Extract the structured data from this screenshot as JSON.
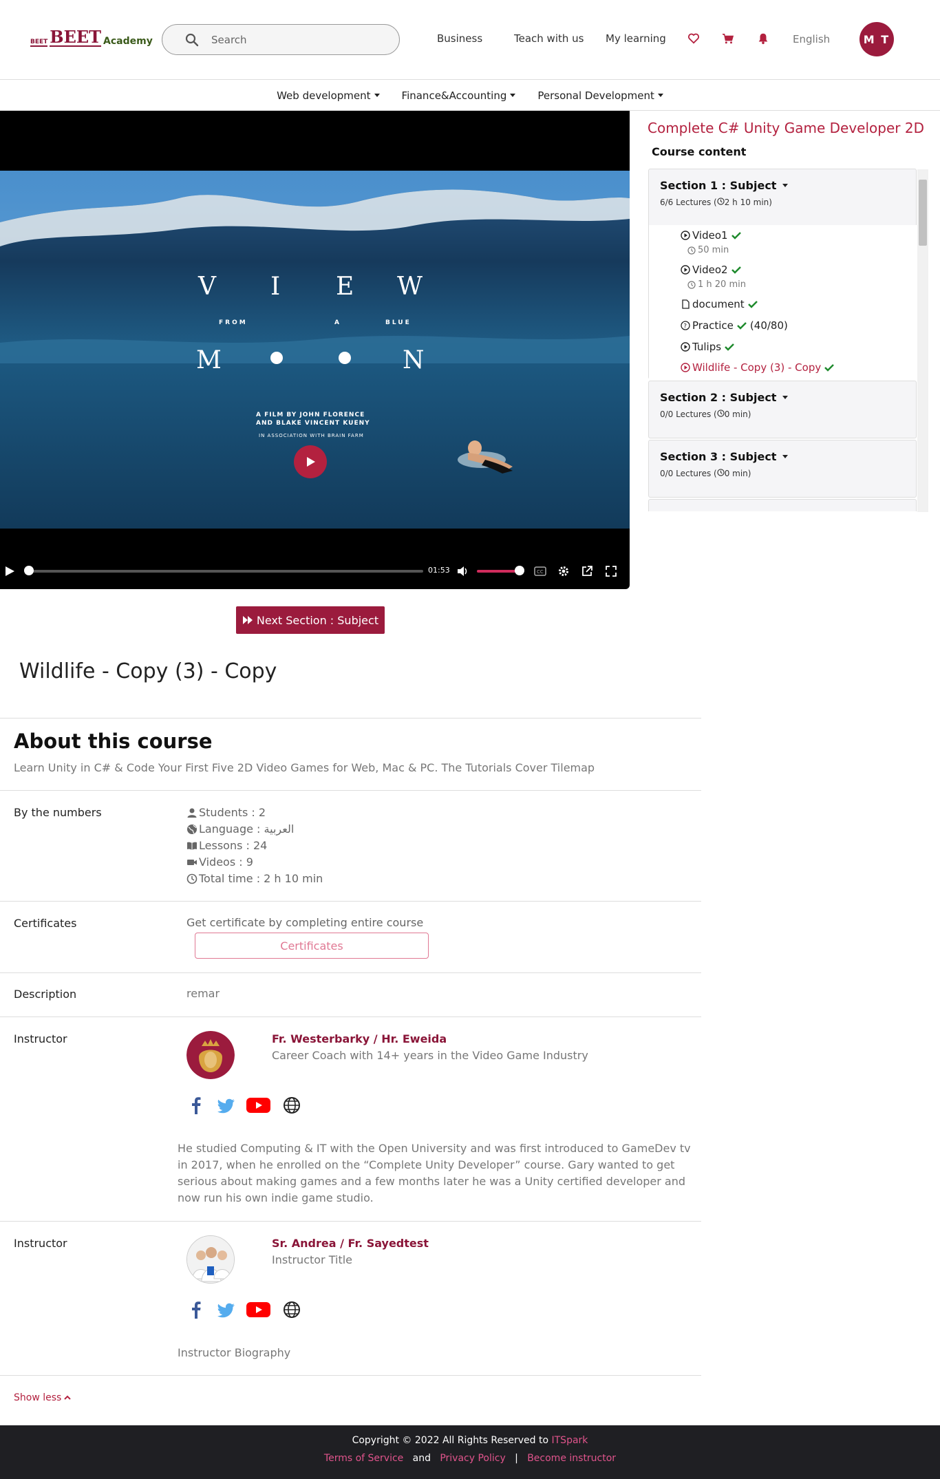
{
  "header": {
    "logo_small": "BEET",
    "logo_main": "BEET",
    "logo_academy": "Academy",
    "search_placeholder": "Search",
    "nav": [
      "Business",
      "Teach with us",
      "My learning"
    ],
    "language": "English",
    "avatar_initials": "M T"
  },
  "categories": [
    "Web development",
    "Finance&Accounting",
    "Personal Development"
  ],
  "video": {
    "poster_title_line1": [
      "V",
      "I",
      "E",
      "W"
    ],
    "poster_title_from": [
      "FROM",
      "A",
      "BLUE"
    ],
    "poster_title_line3": [
      "M",
      "N"
    ],
    "credits": [
      "A FILM BY JOHN FLORENCE",
      "AND BLAKE VINCENT KUENY",
      "IN ASSOCIATION WITH BRAIN FARM"
    ],
    "time": "01:53",
    "colors": {
      "accent": "#b3213f",
      "volume": "#d02c5d"
    }
  },
  "sidebar": {
    "course_title": "Complete C# Unity Game Developer 2D",
    "content_label": "Course content",
    "sections": [
      {
        "name": "Section 1 : Subject",
        "meta": "6/6 Lectures (",
        "duration": "2 h 10 min",
        "lessons": [
          {
            "type": "video",
            "title": "Video1",
            "duration": "50 min",
            "done": true
          },
          {
            "type": "video",
            "title": "Video2",
            "duration": "1 h 20 min",
            "done": true
          },
          {
            "type": "document",
            "title": "document",
            "done": true
          },
          {
            "type": "quiz",
            "title": "Practice",
            "score": "(40/80)",
            "done": true
          },
          {
            "type": "video",
            "title": "Tulips",
            "done": true
          },
          {
            "type": "video",
            "title": "Wildlife - Copy (3) - Copy",
            "done": true,
            "active": true
          }
        ]
      },
      {
        "name": "Section 2 : Subject",
        "meta": "0/0 Lectures (",
        "duration": "0 min"
      },
      {
        "name": "Section 3 : Subject",
        "meta": "0/0 Lectures (",
        "duration": "0 min"
      }
    ]
  },
  "main": {
    "next_button": "Next Section : Subject",
    "lecture_title": "Wildlife - Copy (3) - Copy",
    "about_heading": "About this course",
    "about_sub": "Learn Unity in C# & Code Your First Five 2D Video Games for Web, Mac & PC. The Tutorials Cover Tilemap",
    "numbers_label": "By the numbers",
    "stats": {
      "students": "Students : 2",
      "language": "Language : العربية",
      "lessons": "Lessons : 24",
      "videos": "Videos : 9",
      "total": "Total time : 2 h 10 min"
    },
    "certificates_label": "Certificates",
    "certificates_text": "Get certificate by completing entire course",
    "certificates_button": "Certificates",
    "description_label": "Description",
    "description_text": "remar",
    "instructors": [
      {
        "label": "Instructor",
        "name": "Fr. Westerbarky / Hr. Eweida",
        "title": "Career Coach with 14+ years in the Video Game Industry",
        "bio": "He studied Computing & IT with the Open University and was first introduced to GameDev tv in 2017, when he enrolled on the “Complete Unity Developer” course. Gary wanted to get serious about making games and a few months later he was a Unity certified developer and now run his own indie game studio."
      },
      {
        "label": "Instructor",
        "name": "Sr. Andrea / Fr. Sayedtest",
        "title": "Instructor Title",
        "bio": "Instructor Biography"
      }
    ],
    "show_less": "Show less"
  },
  "footer": {
    "copyright": "Copyright © 2022 All Rights Reserved to",
    "company": "ITSpark",
    "terms": "Terms of Service",
    "and": "and",
    "privacy": "Privacy Policy",
    "sep": "|",
    "become": "Become instructor"
  }
}
